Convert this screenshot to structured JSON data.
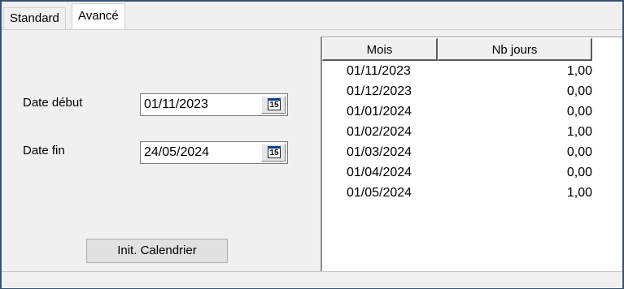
{
  "tabs": [
    {
      "label": "Standard",
      "active": false
    },
    {
      "label": "Avancé",
      "active": true
    }
  ],
  "form": {
    "date_debut_label": "Date début",
    "date_debut_value": "01/11/2023",
    "date_fin_label": "Date fin",
    "date_fin_value": "24/05/2024",
    "calendar_icon_text": "15",
    "init_button_label": "Init. Calendrier"
  },
  "grid": {
    "columns": [
      "Mois",
      "Nb jours"
    ],
    "rows": [
      {
        "mois": "01/11/2023",
        "nb": "1,00"
      },
      {
        "mois": "01/12/2023",
        "nb": "0,00"
      },
      {
        "mois": "01/01/2024",
        "nb": "0,00"
      },
      {
        "mois": "01/02/2024",
        "nb": "1,00"
      },
      {
        "mois": "01/03/2024",
        "nb": "0,00"
      },
      {
        "mois": "01/04/2024",
        "nb": "0,00"
      },
      {
        "mois": "01/05/2024",
        "nb": "1,00"
      }
    ]
  },
  "colors": {
    "frame_border": "#34526f",
    "background": "#f0f0f0",
    "calendar_icon_accent": "#0b3f8a"
  }
}
